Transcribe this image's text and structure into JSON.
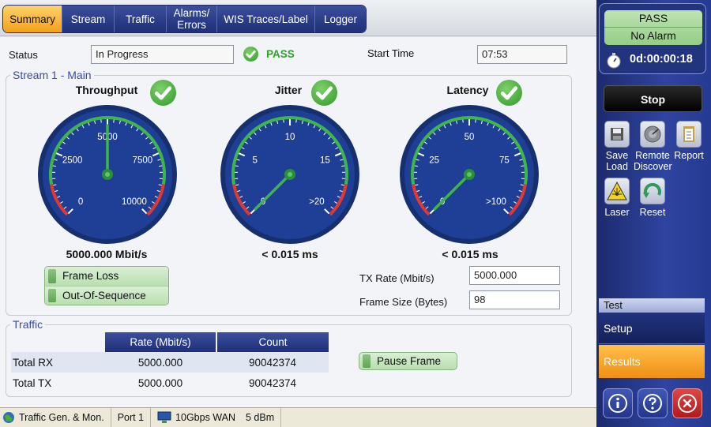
{
  "tabs": [
    "Summary",
    "Stream",
    "Traffic",
    "Alarms/\nErrors",
    "WIS Traces/Label",
    "Logger"
  ],
  "status": {
    "label": "Status",
    "value": "In Progress",
    "result": "PASS"
  },
  "start_time": {
    "label": "Start Time",
    "value": "07:53"
  },
  "stream_group": "Stream 1 - Main",
  "gauges": [
    {
      "title": "Throughput",
      "value_text": "5000.000 Mbit/s",
      "ticks": [
        "0",
        "2500",
        "5000",
        "7500",
        "10000"
      ],
      "needle_fraction": 0.5
    },
    {
      "title": "Jitter",
      "value_text": "< 0.015 ms",
      "ticks": [
        "0",
        "5",
        "10",
        "15",
        ">20"
      ],
      "needle_fraction": 0.0
    },
    {
      "title": "Latency",
      "value_text": "< 0.015 ms",
      "ticks": [
        "0",
        "25",
        "50",
        "75",
        ">100"
      ],
      "needle_fraction": 0.0
    }
  ],
  "indicators": {
    "frame_loss": "Frame Loss",
    "out_of_sequence": "Out-Of-Sequence",
    "pause_frame": "Pause Frame"
  },
  "tx_rate": {
    "label": "TX Rate (Mbit/s)",
    "value": "5000.000"
  },
  "frame_size": {
    "label": "Frame Size (Bytes)",
    "value": "98"
  },
  "traffic": {
    "group": "Traffic",
    "headers": [
      "Rate (Mbit/s)",
      "Count"
    ],
    "rows": [
      {
        "label": "Total RX",
        "rate": "5000.000",
        "count": "90042374"
      },
      {
        "label": "Total TX",
        "rate": "5000.000",
        "count": "90042374"
      }
    ]
  },
  "statusbar": {
    "mode": "Traffic Gen. & Mon.",
    "port": "Port 1",
    "interface": "10Gbps WAN",
    "power": "5 dBm"
  },
  "side": {
    "pass": "PASS",
    "alarm": "No Alarm",
    "timer": "0d:00:00:18",
    "stop": "Stop",
    "tools": {
      "save_load": "Save\nLoad",
      "remote_discover": "Remote\nDiscover",
      "report": "Report",
      "laser": "Laser",
      "reset": "Reset"
    },
    "test_label": "Test",
    "setup": "Setup",
    "results": "Results"
  },
  "colors": {
    "accent_orange": "#f3a11c",
    "tab_blue": "#1f2f78",
    "pass_green": "#2ea02e",
    "gauge_face": "#1f3a8c"
  }
}
